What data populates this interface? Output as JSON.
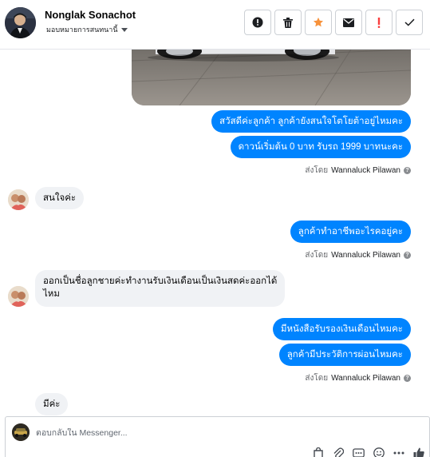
{
  "header": {
    "contact_name": "Nonglak Sonachot",
    "assign_label": "มอบหมายการสนทนานี้"
  },
  "toolbar": {
    "buttons": [
      {
        "name": "report-button",
        "icon": "exclamation-circle-icon"
      },
      {
        "name": "delete-button",
        "icon": "trash-icon"
      },
      {
        "name": "star-button",
        "icon": "star-icon",
        "color": "#f7923b"
      },
      {
        "name": "mark-unread-button",
        "icon": "envelope-icon"
      },
      {
        "name": "spam-button",
        "icon": "exclamation-icon",
        "color": "#fa3e3e"
      },
      {
        "name": "done-button",
        "icon": "check-icon"
      }
    ]
  },
  "messages": [
    {
      "from": "page",
      "text": "สวัสดีค่ะลูกค้า  ลูกค้ายังสนใจโตโยต้าอยู่ไหมคะ"
    },
    {
      "from": "page",
      "text": "ดาวน์เริ่มต้น 0 บาท รับรถ 1999 บาทนะคะ"
    },
    {
      "from": "user",
      "text": "สนใจค่ะ"
    },
    {
      "from": "page",
      "text": "ลูกค้าทำอาชีพอะไรคอยู่คะ"
    },
    {
      "from": "user",
      "lines": [
        "ออกเป็นชื่อลูกชายค่ะทำงานรับเงินเดือนเป็นเงินสดค่ะออกได้",
        "ไหม"
      ]
    },
    {
      "from": "page",
      "text": "มีหนังสือรับรองเงินเดือนไหมคะ"
    },
    {
      "from": "page",
      "text": "ลูกค้ามีประวัติการผ่อนไหมคะ"
    },
    {
      "from": "user",
      "text": "มีค่ะ"
    }
  ],
  "sent_by": {
    "prefix": "ส่งโดย",
    "agent": "Wannaluck Pilawan",
    "help_icon": "question-circle-icon"
  },
  "reply": {
    "placeholder": "ตอบกลับใน Messenger..."
  },
  "colors": {
    "accent": "#0084ff",
    "incoming_bubble": "#f0f2f5"
  }
}
